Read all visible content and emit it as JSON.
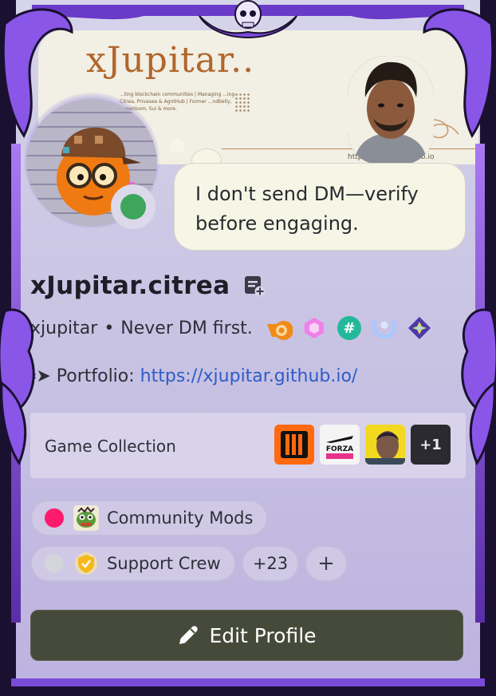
{
  "banner": {
    "brand": "xJupitar..",
    "blurb": "...ting blockchain communities | Managing ...ing Citrea, Privasea & AgntHub | Former ...ndbelly, Powerloom, Sui & more.",
    "url": "https://xjupitar.github.io"
  },
  "status": {
    "message": "I don't send DM—verify before engaging.",
    "presence": "online",
    "presence_color": "#3da55c"
  },
  "profile": {
    "display_name": "xJupitar.citrea",
    "username": "xjupitar",
    "separator": "•",
    "pronouns": "Never DM first.",
    "badges": [
      "nitro-boost-icon",
      "hypesquad-icon",
      "hash-icon",
      "laurel-icon",
      "active-developer-icon"
    ],
    "bio_prefix": "⸗➤ Portfolio: ",
    "bio_link": "https://xjupitar.github.io/"
  },
  "game_collection": {
    "label": "Game Collection",
    "games": [
      "black-ops-iii-icon",
      "forza-horizon-5-icon",
      "cyberpunk-2077-icon"
    ],
    "more_label": "+1"
  },
  "roles": [
    {
      "label": "Community Mods",
      "dot_color": "#ff1a6e",
      "icon": "pepe-icon"
    },
    {
      "label": "Support Crew",
      "dot_color": "#d4d4dc",
      "icon": "shield-icon"
    }
  ],
  "roles_more": "+23",
  "add_role": "+",
  "edit_button": {
    "label": "Edit Profile",
    "bg_color": "#464a3a"
  }
}
